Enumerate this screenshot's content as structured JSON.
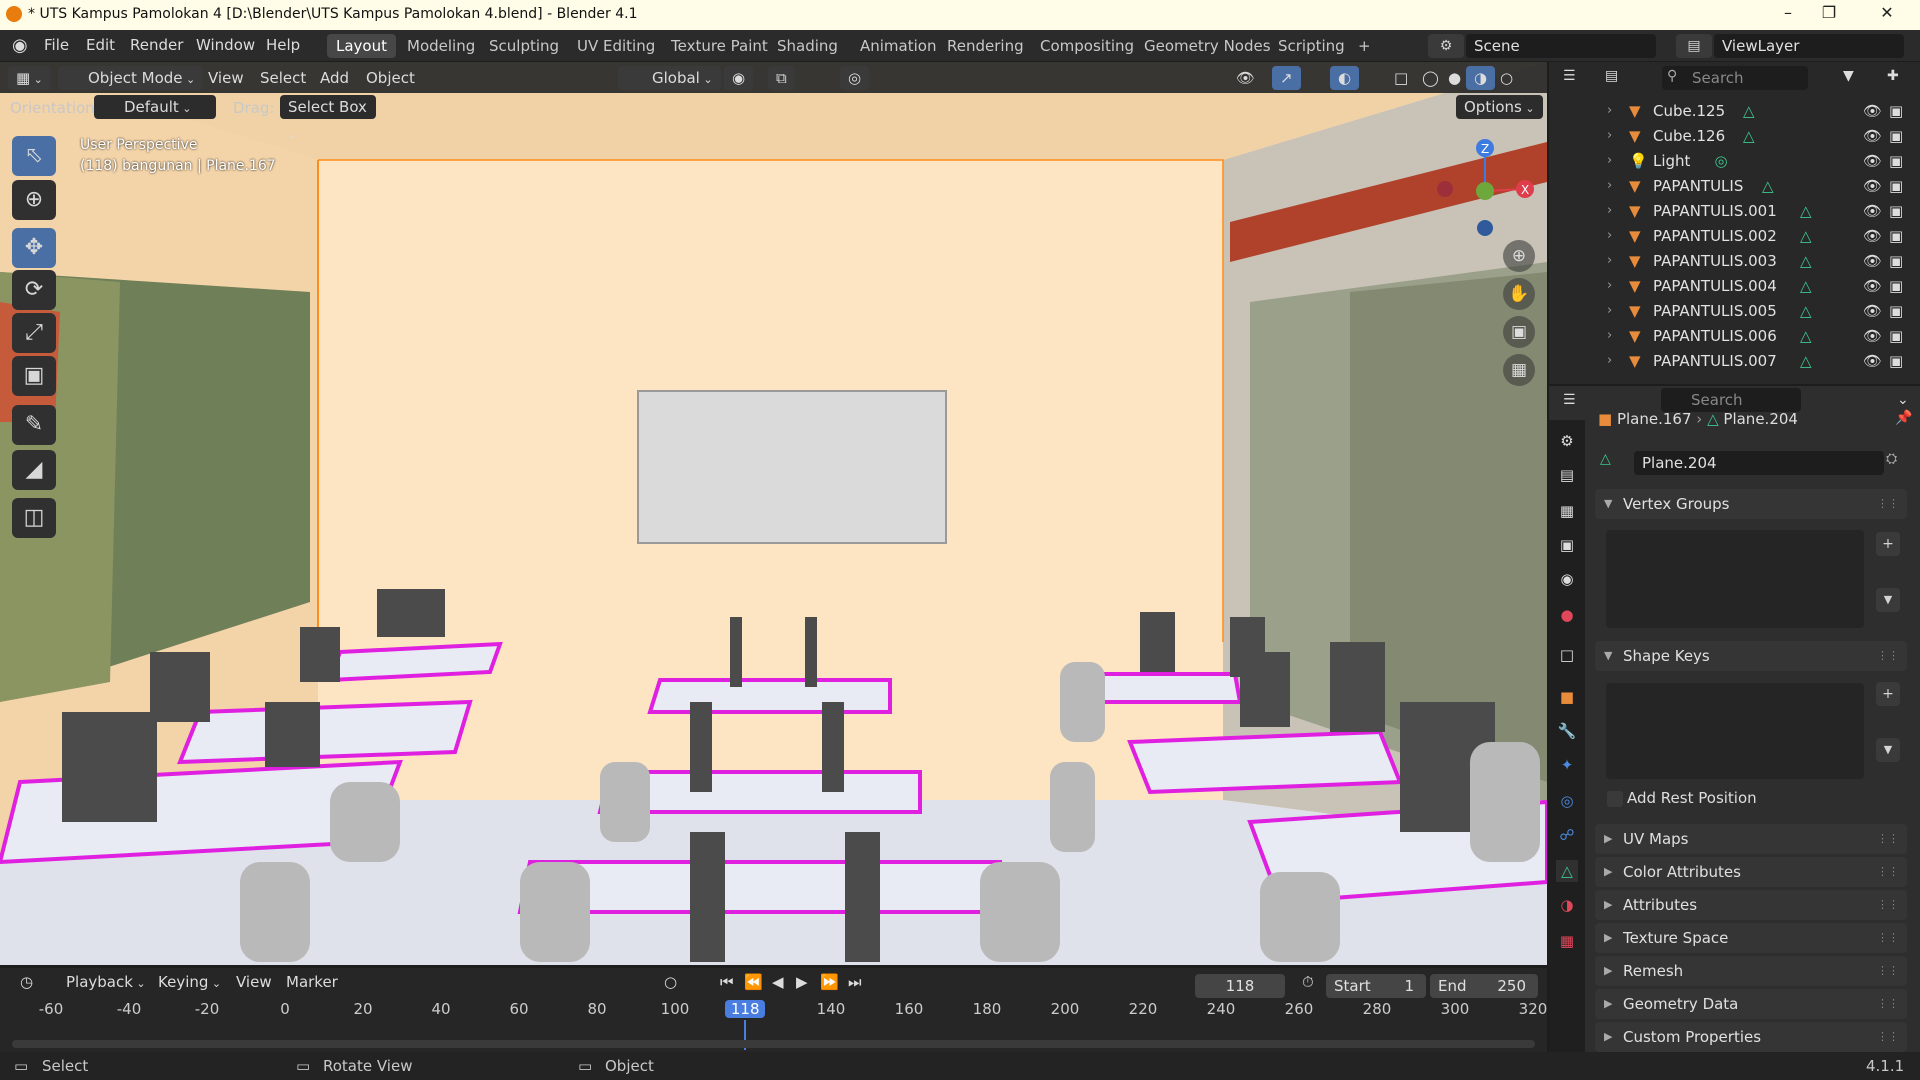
{
  "title_bar": {
    "title": "* UTS Kampus Pamolokan 4 [D:\\Blender\\UTS Kampus Pamolokan 4.blend] - Blender 4.1",
    "minimize": "–",
    "maximize": "❐",
    "close": "✕"
  },
  "menu": {
    "file": "File",
    "edit": "Edit",
    "render": "Render",
    "window": "Window",
    "help": "Help"
  },
  "workspaces": [
    "Layout",
    "Modeling",
    "Sculpting",
    "UV Editing",
    "Texture Paint",
    "Shading",
    "Animation",
    "Rendering",
    "Compositing",
    "Geometry Nodes",
    "Scripting",
    "+"
  ],
  "scene": {
    "name": "Scene",
    "view_layer": "ViewLayer"
  },
  "viewport_header": {
    "mode": "Object Mode",
    "view": "View",
    "select": "Select",
    "add": "Add",
    "object": "Object",
    "transform": "Global"
  },
  "viewport_options": {
    "orientation_label": "Orientation:",
    "orientation_value": "Default",
    "drag_label": "Drag:",
    "drag_value": "Select Box",
    "options": "Options"
  },
  "viewport_info": {
    "perspective": "User Perspective",
    "object_info": "(118) bangunan | Plane.167"
  },
  "gizmo": {
    "z": "Z",
    "y": "Y",
    "x": "X"
  },
  "outliner": {
    "search_placeholder": "Search",
    "items": [
      "Cube.125",
      "Cube.126",
      "Light",
      "PAPANTULIS",
      "PAPANTULIS.001",
      "PAPANTULIS.002",
      "PAPANTULIS.003",
      "PAPANTULIS.004",
      "PAPANTULIS.005",
      "PAPANTULIS.006",
      "PAPANTULIS.007"
    ]
  },
  "properties": {
    "search_placeholder": "Search",
    "breadcrumb_object": "Plane.167",
    "breadcrumb_data": "Plane.204",
    "data_name": "Plane.204",
    "panels": {
      "vertex_groups": "Vertex Groups",
      "shape_keys": "Shape Keys",
      "add_rest_position": "Add Rest Position",
      "uv_maps": "UV Maps",
      "color_attributes": "Color Attributes",
      "attributes": "Attributes",
      "texture_space": "Texture Space",
      "remesh": "Remesh",
      "geometry_data": "Geometry Data",
      "custom_properties": "Custom Properties"
    }
  },
  "timeline": {
    "playback": "Playback",
    "keying": "Keying",
    "view": "View",
    "marker": "Marker",
    "current_frame": "118",
    "start_label": "Start",
    "start": "1",
    "end_label": "End",
    "end": "250",
    "ticks": [
      "-60",
      "-40",
      "-20",
      "0",
      "20",
      "40",
      "60",
      "80",
      "100",
      "118",
      "140",
      "160",
      "180",
      "200",
      "220",
      "240",
      "260",
      "280",
      "300",
      "320"
    ]
  },
  "status_bar": {
    "select": "Select",
    "rotate_view": "Rotate View",
    "object": "Object",
    "version": "4.1.1"
  },
  "colors": {
    "accent": "#4a6fa5",
    "selection_orange": "#ff8c1a",
    "mesh_green": "#3cc78f",
    "object_orange": "#e88c3c",
    "magenta_desk": "#e020e0"
  }
}
